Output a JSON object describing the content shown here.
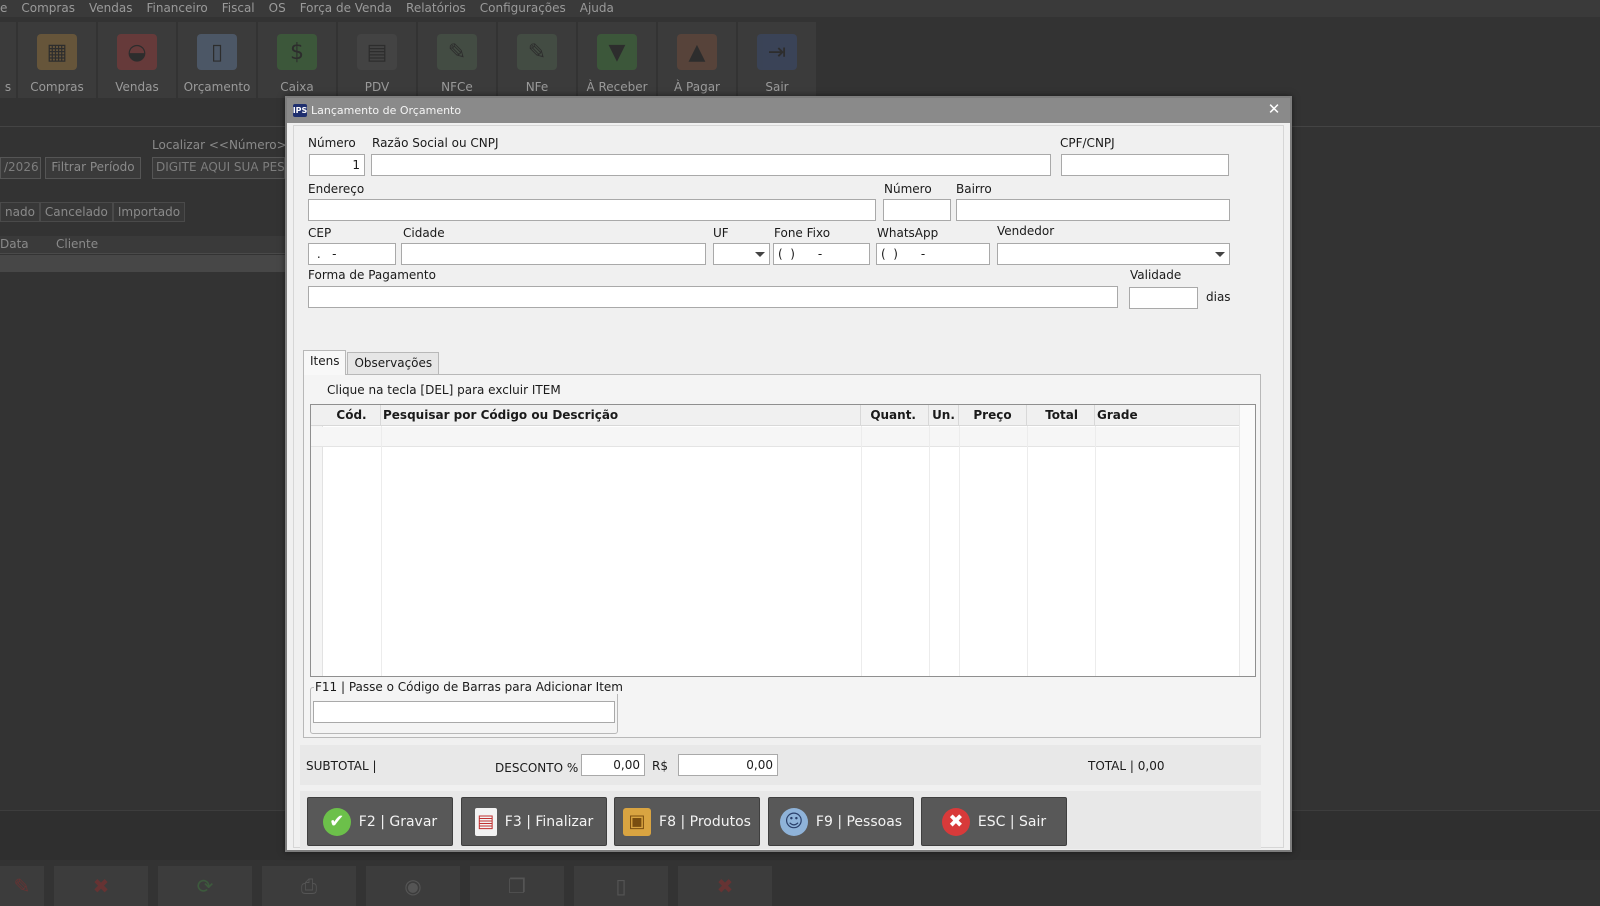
{
  "background": {
    "menu": [
      "e",
      "Compras",
      "Vendas",
      "Financeiro",
      "Fiscal",
      "OS",
      "Força de Venda",
      "Relatórios",
      "Configurações",
      "Ajuda"
    ],
    "toolbar": [
      {
        "label": "s",
        "icon": "partial-icon"
      },
      {
        "label": "Compras",
        "icon": "store-icon"
      },
      {
        "label": "Vendas",
        "icon": "basket-icon"
      },
      {
        "label": "Orçamento",
        "icon": "book-icon"
      },
      {
        "label": "Caixa",
        "icon": "money-bag-icon"
      },
      {
        "label": "PDV",
        "icon": "pos-terminal-icon"
      },
      {
        "label": "NFCe",
        "icon": "nfce-icon"
      },
      {
        "label": "NFe",
        "icon": "nfe-icon"
      },
      {
        "label": "À Receber",
        "icon": "receive-money-icon"
      },
      {
        "label": "À Pagar",
        "icon": "pay-money-icon"
      },
      {
        "label": "Sair",
        "icon": "exit-icon"
      }
    ],
    "date_field": "/2026",
    "filter_button": "Filtrar Período",
    "search_label": "Localizar <<Número>>",
    "search_placeholder": "DIGITE AQUI SUA PESQ",
    "status_tabs": [
      "nado",
      "Cancelado",
      "Importado"
    ],
    "grid_headers": [
      "Data",
      "Cliente"
    ]
  },
  "modal": {
    "title": "Lançamento de Orçamento",
    "app_icon_text": "IPS",
    "close": "✕",
    "labels": {
      "numero": "Número",
      "razao": "Razão Social ou CNPJ",
      "cpf": "CPF/CNPJ",
      "endereco": "Endereço",
      "numero2": "Número",
      "bairro": "Bairro",
      "cep": "CEP",
      "cidade": "Cidade",
      "uf": "UF",
      "fone": "Fone Fixo",
      "whatsapp": "WhatsApp",
      "vendedor": "Vendedor",
      "pagamento": "Forma de Pagamento",
      "validade": "Validade",
      "dias": "dias"
    },
    "values": {
      "numero": "1",
      "razao": "",
      "cpf": "",
      "endereco": "",
      "numero2": "",
      "bairro": "",
      "cep": " .   -",
      "cidade": "",
      "fone": "(  )      -",
      "whatsapp": "(  )      -",
      "pagamento": "",
      "validade": ""
    },
    "tabs": [
      "Itens",
      "Observações"
    ],
    "hint": "Clique na tecla [DEL] para excluir ITEM",
    "grid_headers": [
      "Cód.",
      "Pesquisar por Código ou Descrição",
      "Quant.",
      "Un.",
      "Preço",
      "Total",
      "Grade"
    ],
    "barcode_legend": "F11 | Passe o Código de Barras para Adicionar Item",
    "totals": {
      "subtotal": "SUBTOTAL  |",
      "desconto": "DESCONTO %",
      "desconto_pct": "0,00",
      "currency": "R$",
      "desconto_val": "0,00",
      "total": "TOTAL  | 0,00"
    },
    "buttons": [
      {
        "label": "F2 | Gravar",
        "icon": "check-icon",
        "color": "#6cc04a"
      },
      {
        "label": "F3 | Finalizar",
        "icon": "document-icon",
        "color": "#e8e8e8"
      },
      {
        "label": "F8 | Produtos",
        "icon": "box-icon",
        "color": "#d9a441"
      },
      {
        "label": "F9 | Pessoas",
        "icon": "person-icon",
        "color": "#8fb3d9"
      },
      {
        "label": "ESC | Sair",
        "icon": "cancel-icon",
        "color": "#d83a3a"
      }
    ]
  }
}
